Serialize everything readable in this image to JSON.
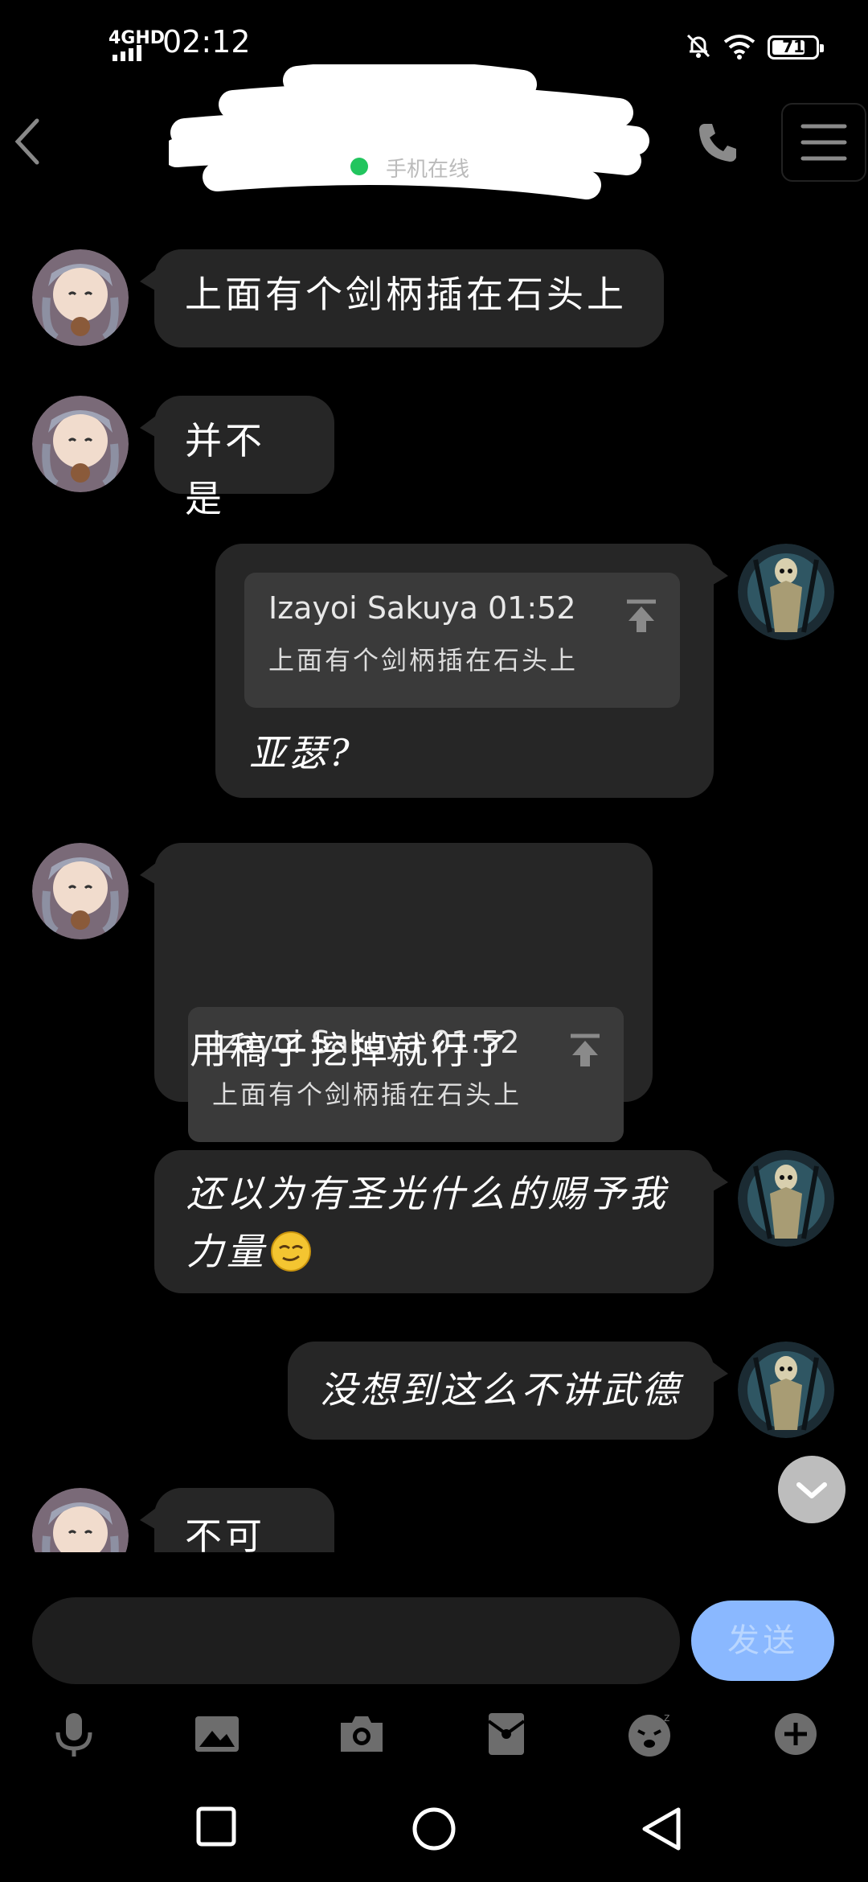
{
  "status_bar": {
    "network": "4GHD",
    "time": "02:12",
    "battery": "71"
  },
  "header": {
    "status_text": "手机在线"
  },
  "messages": [
    {
      "side": "left",
      "text": "上面有个剑柄插在石头上"
    },
    {
      "side": "left",
      "text": "并不是"
    },
    {
      "side": "right",
      "quote_name": "Izayoi Sakuya 01:52",
      "quote_text": "上面有个剑柄插在石头上",
      "text": "亚瑟?"
    },
    {
      "side": "left",
      "quote_name": "Izayoi Sakuya 01:52",
      "quote_text": "上面有个剑柄插在石头上",
      "text": "用稿子挖掉就行了"
    },
    {
      "side": "right",
      "text_line1": "还以为有圣光什么的赐予我",
      "text_line2": "力量"
    },
    {
      "side": "right",
      "text": "没想到这么不讲武德"
    },
    {
      "side": "left",
      "text": "不可能"
    }
  ],
  "input": {
    "placeholder": "",
    "send_label": "发送"
  },
  "toolbar": [
    "mic-icon",
    "image-icon",
    "camera-icon",
    "red-packet-icon",
    "emoji-icon",
    "plus-icon"
  ],
  "colors": {
    "background": "#000000",
    "bubble": "#262626",
    "quote": "#3a3a3a",
    "online": "#22c55e",
    "send": "#8ab8ff"
  }
}
